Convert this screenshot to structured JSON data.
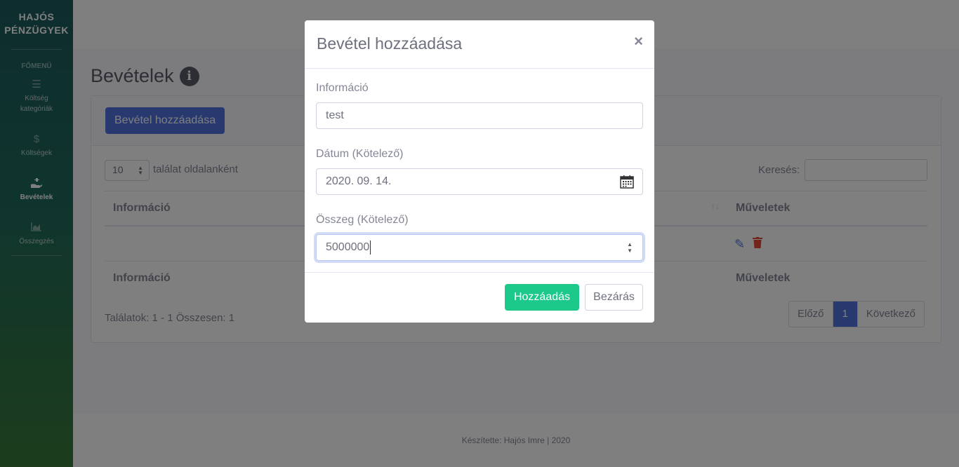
{
  "brand": "HAJÓS PÉNZÜGYEK",
  "sidebar": {
    "heading": "FŐMENÜ",
    "items": [
      {
        "label": "Költség kategóriák",
        "icon": "list-icon"
      },
      {
        "label": "Költségek",
        "icon": "dollar-icon"
      },
      {
        "label": "Bevételek",
        "icon": "hand-holding-usd-icon"
      },
      {
        "label": "Összegzés",
        "icon": "chart-area-icon"
      }
    ]
  },
  "page": {
    "title": "Bevételek"
  },
  "card": {
    "add_button": "Bevétel hozzáadása",
    "page_length": "10",
    "page_length_label": "találat oldalanként",
    "search_label": "Keresés:",
    "col_info": "Információ",
    "col_actions": "Műveletek",
    "found_text": "Találatok: 1 - 1 Összesen: 1",
    "pager": {
      "prev": "Előző",
      "current": "1",
      "next": "Következő"
    }
  },
  "footer": {
    "text": "Készítette: Hajós Imre | 2020"
  },
  "modal": {
    "title": "Bevétel hozzáadása",
    "close": "×",
    "info_label": "Információ",
    "info_value": "test",
    "date_label": "Dátum (Kötelező)",
    "date_value": "2020. 09. 14.",
    "amount_label": "Összeg (Kötelező)",
    "amount_value": "5000000",
    "submit": "Hozzáadás",
    "dismiss": "Bezárás"
  }
}
